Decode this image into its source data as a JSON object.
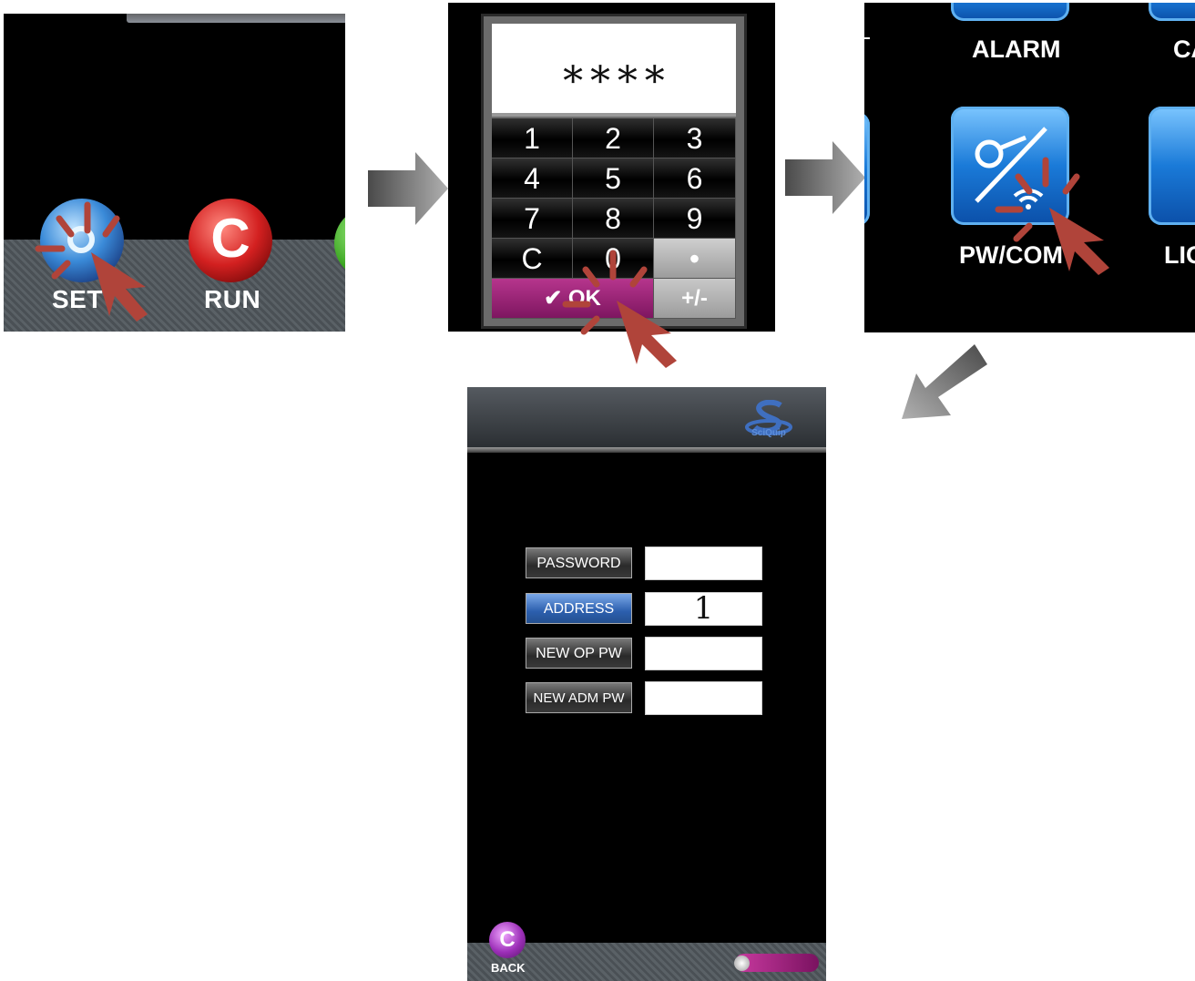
{
  "step1": {
    "set_label": "SET",
    "run_label": "RUN"
  },
  "step2": {
    "display": "∗∗∗∗",
    "keys": [
      "1",
      "2",
      "3",
      "4",
      "5",
      "6",
      "7",
      "8",
      "9",
      "C",
      "0",
      "•"
    ],
    "ok_label": "✔ OK",
    "plusminus_label": "+/-"
  },
  "step3": {
    "alarm_label": "ALARM",
    "cal_label": "CA",
    "pwcom_label": "PW/COM",
    "light_label": "LIG"
  },
  "step4": {
    "brand": "SciQuip",
    "rows": [
      {
        "label": "PASSWORD",
        "value": "",
        "active": false
      },
      {
        "label": "ADDRESS",
        "value": "1",
        "active": true
      },
      {
        "label": "NEW OP PW",
        "value": "",
        "active": false
      },
      {
        "label": "NEW ADM PW",
        "value": "",
        "active": false
      }
    ],
    "back_label": "BACK"
  },
  "colors": {
    "pointer": "#b0443a",
    "arrow": "#808080",
    "accent": "#9c2fb8",
    "tile_blue": "#1a7ad8"
  }
}
